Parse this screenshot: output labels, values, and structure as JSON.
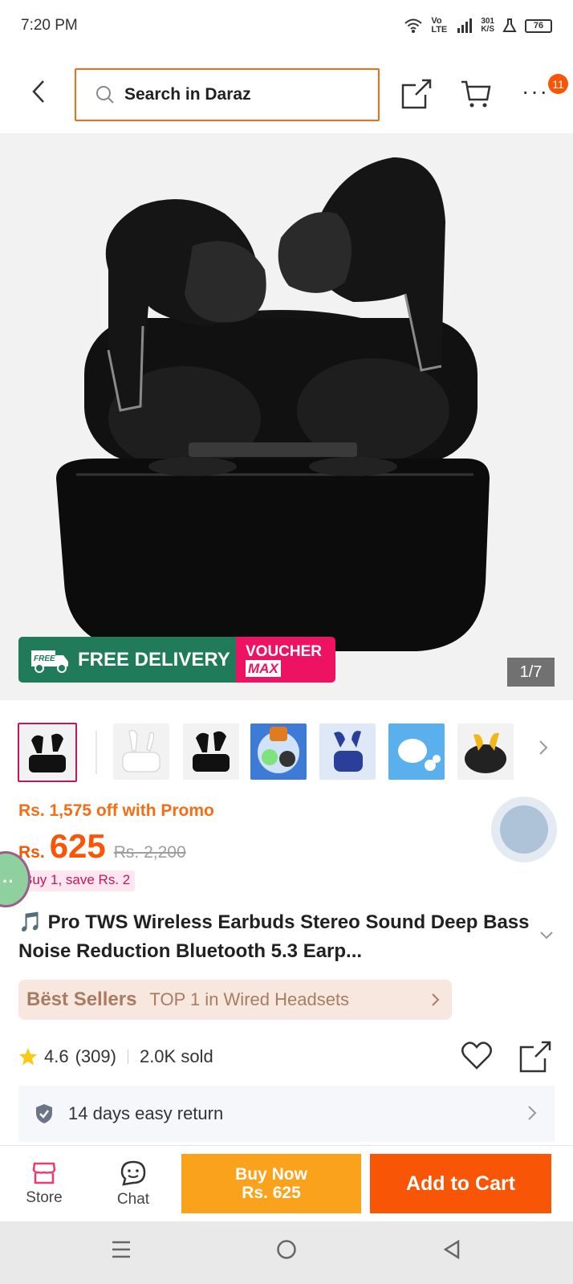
{
  "status_bar": {
    "time": "7:20 PM",
    "network": "Vo LTE",
    "speed_value": "301",
    "speed_unit": "K/S",
    "battery": "76"
  },
  "header": {
    "search_placeholder": "Search in Daraz",
    "cart_badge": "11"
  },
  "gallery": {
    "counter": "1/7",
    "free_badge": "FREE",
    "free_delivery": "FREE DELIVERY",
    "voucher_line1": "VOUCHER",
    "voucher_line2": "MAX"
  },
  "thumbnails": [
    {
      "label": "black-earbuds",
      "active": true
    },
    {
      "label": "white-earbuds"
    },
    {
      "label": "black-earbuds-alt"
    },
    {
      "label": "earbuds-collage"
    },
    {
      "label": "blue-earbuds"
    },
    {
      "label": "white-earbuds-blue-bg"
    },
    {
      "label": "yellow-earbuds"
    }
  ],
  "pricing": {
    "promo_text": "Rs. 1,575 off with Promo",
    "currency": "Rs.",
    "price": "625",
    "old_price": "Rs. 2,200",
    "save_text": "Buy 1, save Rs. 2"
  },
  "product": {
    "title_icon": "🎵",
    "title": "Pro TWS Wireless Earbuds Stereo Sound Deep Bass Noise Reduction Bluetooth 5.3 Earp..."
  },
  "bestseller": {
    "brand": "Bëst Sellers",
    "text": "TOP 1 in Wired Headsets"
  },
  "rating": {
    "score": "4.6",
    "count": "(309)",
    "sold": "2.0K sold"
  },
  "return_policy": {
    "text": "14 days easy return"
  },
  "bottom_bar": {
    "store": "Store",
    "chat": "Chat",
    "buy_now_line1": "Buy Now",
    "buy_now_line2": "Rs. 625",
    "add_to_cart": "Add to Cart"
  },
  "colors": {
    "accent": "#f85606",
    "buy_now": "#faa21c",
    "free_delivery": "#1f7b59",
    "voucher": "#ee1262"
  }
}
